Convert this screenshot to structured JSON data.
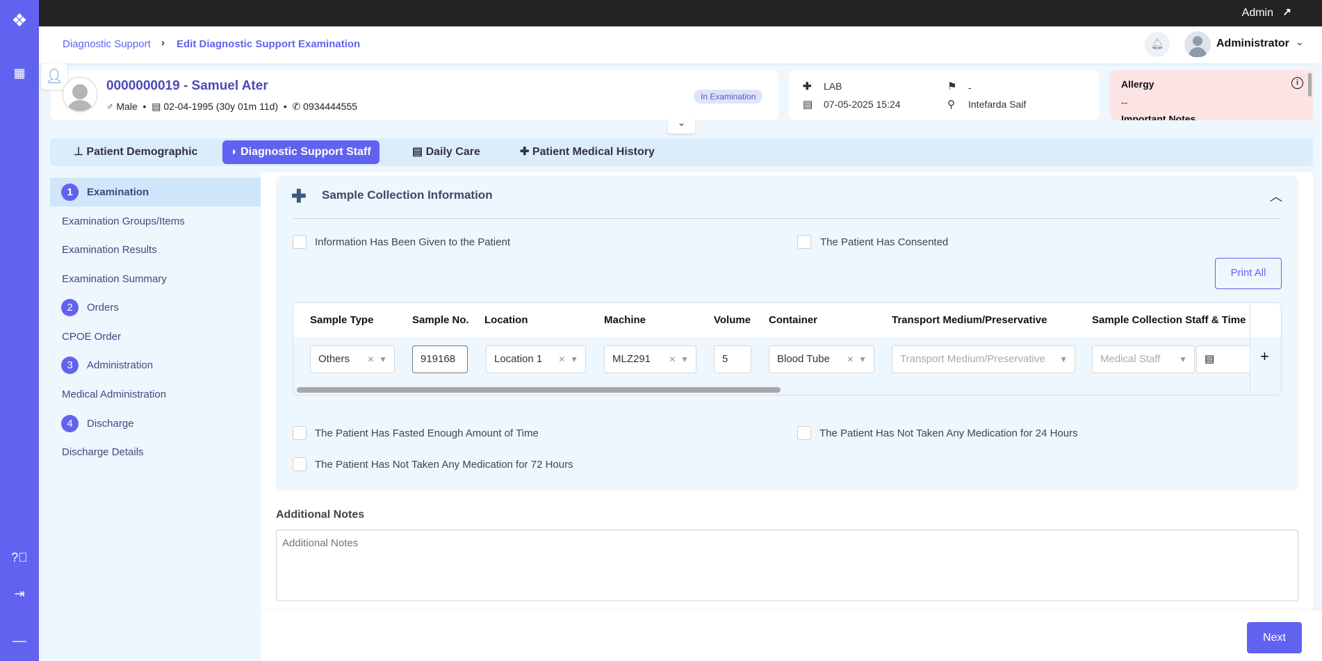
{
  "topbar": {
    "user": "Admin"
  },
  "header": {
    "breadcrumb": [
      "Diagnostic Support",
      "Edit Diagnostic Support Examination"
    ],
    "user_name": "Administrator"
  },
  "patient": {
    "id_name": "0000000019 - Samuel Ater",
    "gender": "Male",
    "dob": "02-04-1995 (30y 01m 11d)",
    "phone": "0934444555",
    "status": "In Examination"
  },
  "visit": {
    "department": "LAB",
    "datetime": "07-05-2025 15:24",
    "flag": "-",
    "doctor": "Intefarda Saif"
  },
  "allergy": {
    "title": "Allergy",
    "value": "--",
    "notes_title": "Important Notes"
  },
  "tabs": [
    {
      "label": "Patient Demographic"
    },
    {
      "label": "Diagnostic Support Staff"
    },
    {
      "label": "Daily Care"
    },
    {
      "label": "Patient Medical History"
    }
  ],
  "steps": [
    {
      "num": "1",
      "label": "Examination",
      "header": true
    },
    {
      "label": "Examination Groups/Items"
    },
    {
      "label": "Examination Results"
    },
    {
      "label": "Examination Summary"
    },
    {
      "num": "2",
      "label": "Orders",
      "header": true
    },
    {
      "label": "CPOE Order"
    },
    {
      "num": "3",
      "label": "Administration",
      "header": true
    },
    {
      "label": "Medical Administration"
    },
    {
      "num": "4",
      "label": "Discharge",
      "header": true
    },
    {
      "label": "Discharge Details"
    }
  ],
  "section": {
    "title": "Sample Collection Information",
    "checks_top": [
      {
        "label": "Information Has Been Given to the Patient",
        "checked": false
      },
      {
        "label": "The Patient Has Consented",
        "checked": false
      }
    ],
    "print_all": "Print All",
    "columns": [
      "Sample Type",
      "Sample No.",
      "Location",
      "Machine",
      "Volume",
      "Container",
      "Transport Medium/Preservative",
      "Sample Collection Staff & Time"
    ],
    "row": {
      "sample_type": "Others",
      "sample_no": "919168",
      "location": "Location 1",
      "machine": "MLZ291",
      "volume": "5",
      "container": "Blood Tube",
      "transport_placeholder": "Transport Medium/Preservative",
      "staff_placeholder": "Medical Staff"
    },
    "add": "+",
    "checks_bottom": [
      {
        "label": "The Patient Has Fasted Enough Amount of Time",
        "checked": false
      },
      {
        "label": "The Patient Has Not Taken Any Medication for 24 Hours",
        "checked": false
      },
      {
        "label": "The Patient Has Not Taken Any Medication for 72 Hours",
        "checked": false
      }
    ]
  },
  "notes": {
    "label": "Additional Notes",
    "placeholder": "Additional Notes",
    "value": ""
  },
  "footer": {
    "next": "Next"
  },
  "colors": {
    "accent": "#6262f0",
    "topbar": "#232323",
    "allergy_bg": "#fde4e4"
  }
}
